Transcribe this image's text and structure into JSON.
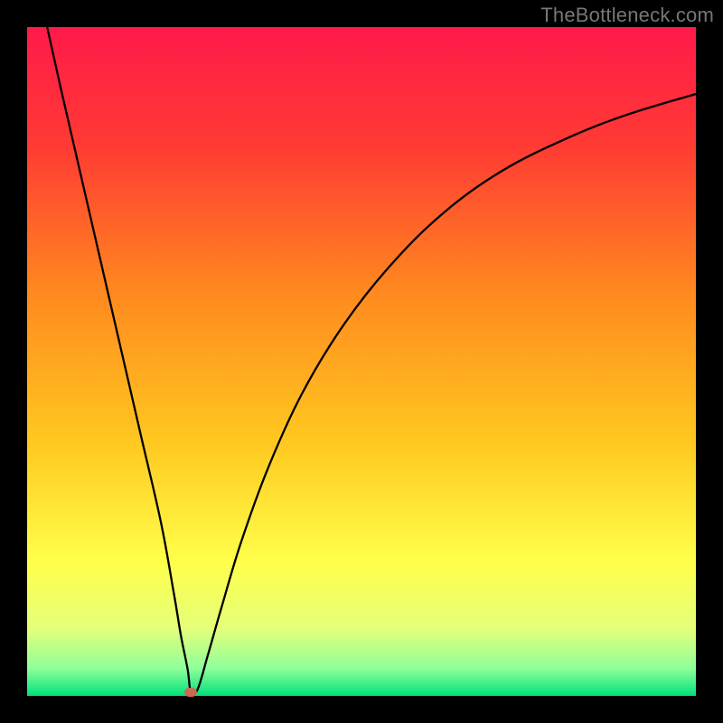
{
  "attribution": "TheBottleneck.com",
  "colors": {
    "background": "#000000",
    "curve": "#000000",
    "marker": "#c96a55",
    "gradient_stops": [
      {
        "pct": 0,
        "color": "#ff1a4a"
      },
      {
        "pct": 18,
        "color": "#ff3b33"
      },
      {
        "pct": 40,
        "color": "#ff8a1f"
      },
      {
        "pct": 62,
        "color": "#ffc81f"
      },
      {
        "pct": 80,
        "color": "#ffff4a"
      },
      {
        "pct": 90,
        "color": "#e4ff7a"
      },
      {
        "pct": 96,
        "color": "#8cff9a"
      },
      {
        "pct": 100,
        "color": "#00e07a"
      }
    ]
  },
  "chart_data": {
    "type": "line",
    "title": "",
    "xlabel": "",
    "ylabel": "",
    "xlim": [
      0,
      100
    ],
    "ylim": [
      0,
      100
    ],
    "grid": false,
    "legend": false,
    "series": [
      {
        "name": "bottleneck-curve",
        "x": [
          3,
          5,
          8,
          11,
          14,
          17,
          20,
          22,
          23,
          24,
          24.5,
          25.5,
          27,
          29,
          32,
          36,
          41,
          47,
          54,
          62,
          71,
          81,
          90,
          100
        ],
        "y": [
          100,
          91,
          78,
          65,
          52,
          39,
          26,
          15,
          9,
          4,
          0.5,
          1,
          6,
          13,
          23,
          34,
          45,
          55,
          64,
          72,
          78.5,
          83.5,
          87,
          90
        ]
      }
    ],
    "marker": {
      "x": 24.5,
      "y": 0.5
    }
  }
}
